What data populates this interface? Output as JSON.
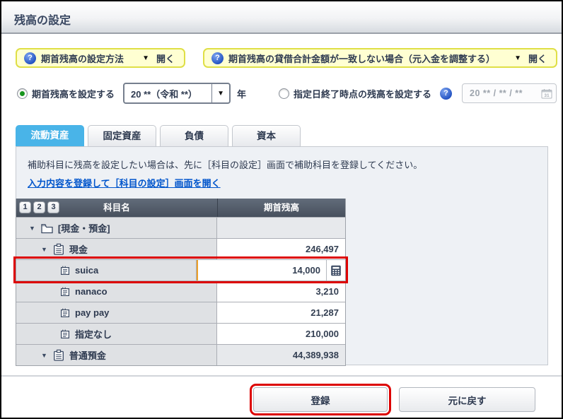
{
  "title": "残高の設定",
  "help_bars": [
    {
      "label": "期首残高の設定方法",
      "action": "開く"
    },
    {
      "label": "期首残高の貸借合計金額が一致しない場合（元入金を調整する）",
      "action": "開く"
    }
  ],
  "period": {
    "radio_opening_label": "期首残高を設定する",
    "radio_opening_selected": true,
    "year_select_value": "20 **（令和 **）",
    "year_suffix": "年",
    "radio_date_label": "指定日終了時点の残高を設定する",
    "radio_date_selected": false,
    "date_value": "20 ** / ** / **",
    "calendar_day": "31"
  },
  "tabs": [
    {
      "label": "流動資産",
      "active": true
    },
    {
      "label": "固定資産",
      "active": false
    },
    {
      "label": "負債",
      "active": false
    },
    {
      "label": "資本",
      "active": false
    }
  ],
  "notice": "補助科目に残高を設定したい場合は、先に［科目の設定］画面で補助科目を登録してください。",
  "link_label": "入力内容を登録して［科目の設定］画面を開く",
  "table": {
    "pager_buttons": [
      "1",
      "2",
      "3"
    ],
    "columns": [
      "科目名",
      "期首残高"
    ],
    "rows": [
      {
        "name": "[現金・預金]",
        "value": "",
        "level": 0,
        "icon": "folder-icon",
        "caret": true,
        "value_gray": true,
        "editing": false,
        "highlight": false
      },
      {
        "name": "現金",
        "value": "246,497",
        "level": 1,
        "icon": "clipboard-icon",
        "caret": true,
        "value_gray": false,
        "editing": false,
        "highlight": false
      },
      {
        "name": "suica",
        "value": "14,000",
        "level": 2,
        "icon": "book-icon",
        "caret": false,
        "value_gray": false,
        "editing": true,
        "highlight": true
      },
      {
        "name": "nanaco",
        "value": "3,210",
        "level": 2,
        "icon": "book-icon",
        "caret": false,
        "value_gray": false,
        "editing": false,
        "highlight": false
      },
      {
        "name": "pay pay",
        "value": "21,287",
        "level": 2,
        "icon": "book-icon",
        "caret": false,
        "value_gray": false,
        "editing": false,
        "highlight": false
      },
      {
        "name": "指定なし",
        "value": "210,000",
        "level": 2,
        "icon": "book-icon",
        "caret": false,
        "value_gray": false,
        "editing": false,
        "highlight": false
      },
      {
        "name": "普通預金",
        "value": "44,389,938",
        "level": 1,
        "icon": "clipboard-icon",
        "caret": true,
        "value_gray": true,
        "editing": false,
        "highlight": false
      }
    ]
  },
  "footer": {
    "register_label": "登録",
    "revert_label": "元に戻す",
    "register_highlighted": true
  },
  "colors": {
    "active_tab_blue": "#49b4e8",
    "annotation_red": "#dd0000",
    "link_blue": "#0055cc",
    "help_bar_bg": "#ffffd2",
    "help_bar_border": "#dfdf46",
    "edit_accent_orange": "#eda028",
    "radio_green": "#18951e",
    "header_slate": "#47505d"
  }
}
